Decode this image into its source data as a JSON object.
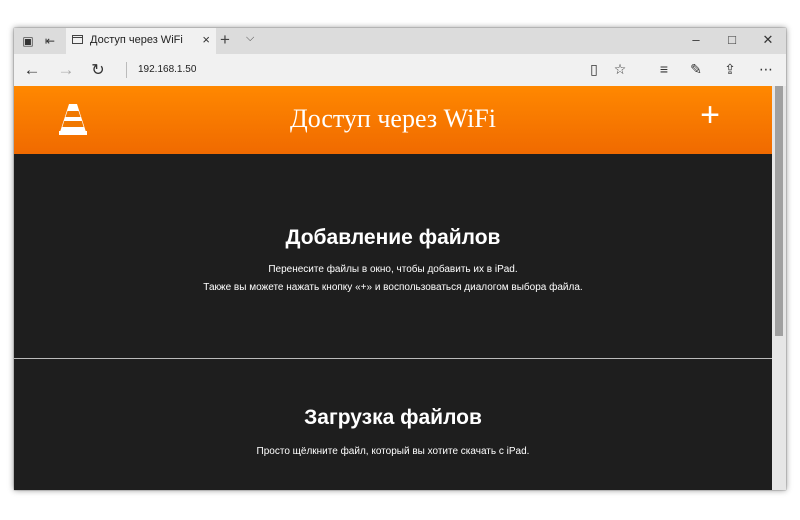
{
  "window": {
    "tab_title": "Доступ через WiFi",
    "close_tab_symbol": "×",
    "new_tab_symbol": "+",
    "tabs_menu_symbol": "⌵"
  },
  "navbar": {
    "address": "192.168.1.50"
  },
  "page": {
    "header_title": "Доступ через WiFi",
    "add_symbol": "+",
    "accent_color": "#ff8800",
    "background_color": "#1e1e1e",
    "upload_section": {
      "title": "Добавление файлов",
      "line1": "Перенесите файлы в окно, чтобы добавить их в iPad.",
      "line2": "Также вы можете нажать кнопку «+» и воспользоваться диалогом выбора файла."
    },
    "download_section": {
      "title": "Загрузка файлов",
      "line1": "Просто щёлкните файл, который вы хотите скачать с iPad."
    }
  },
  "icons": [
    "tab-preview-icon",
    "set-aside-icon",
    "page-icon",
    "close-icon",
    "plus-icon",
    "chevron-down-icon",
    "minimize-icon",
    "maximize-icon",
    "window-close-icon",
    "back-icon",
    "forward-icon",
    "refresh-icon",
    "reading-view-icon",
    "favorite-star-icon",
    "hub-icon",
    "web-note-icon",
    "share-icon",
    "more-icon",
    "vlc-cone-icon"
  ]
}
